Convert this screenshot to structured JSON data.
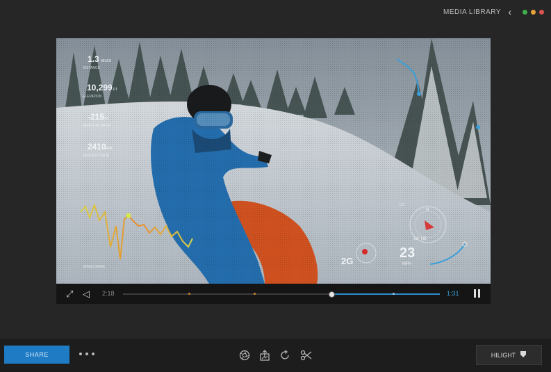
{
  "header": {
    "title": "MEDIA LIBRARY",
    "back_icon": "chevron-left-icon",
    "window_dots": [
      "#3fae49",
      "#e5a23a",
      "#d9534f"
    ]
  },
  "overlay": {
    "stat1_value": "1.3",
    "stat1_unit": "MILES",
    "stat1_label": "DISTANCE",
    "stat2_value": "10,299",
    "stat2_unit": "FT",
    "stat2_label": "ELEVATION",
    "stat3_value": "-215",
    "stat3_unit": "FT",
    "stat3_label": "VERTICAL DROP",
    "stat4_value": "2410",
    "stat4_unit": "FPM",
    "stat4_label": "DESCENT RATE",
    "speed_graph_label": "SPEED RANK",
    "speed_value": "23",
    "speed_unit": "MPH",
    "g_value": "2G",
    "heading": "32° NE",
    "compass_n": "N",
    "alt_label": "150"
  },
  "controls": {
    "elapsed": "2:18",
    "total": "1:31",
    "progress": 0.66,
    "fullscreen_icon": "fullscreen-icon",
    "volume_icon": "volume-icon",
    "pause_icon": "pause-icon"
  },
  "bottom": {
    "share_label": "SHARE",
    "more_icon": "more-dots-icon",
    "tools": [
      "lens-icon",
      "export-icon",
      "rotate-icon",
      "trim-icon"
    ],
    "highlight_label": "HILIGHT",
    "highlight_icon": "shield-icon"
  }
}
